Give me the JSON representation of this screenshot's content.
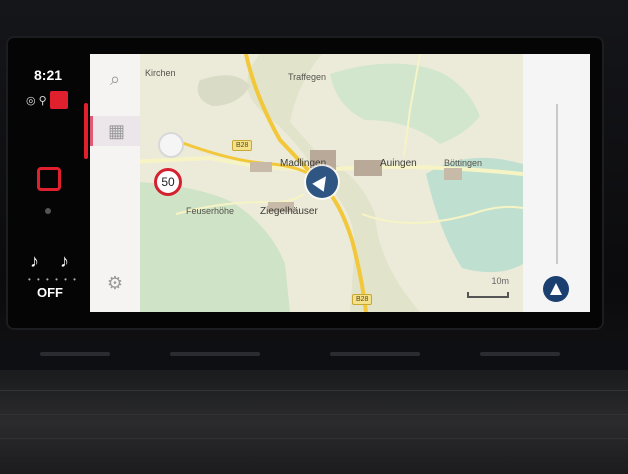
{
  "status": {
    "time": "8:21",
    "climate_label": "OFF"
  },
  "sidebar_tools": [
    {
      "name": "search-tool",
      "icon": "search-icon"
    },
    {
      "name": "map-view-tool",
      "icon": "map-icon",
      "active": true
    },
    {
      "name": "settings-tool",
      "icon": "gear-icon"
    }
  ],
  "map": {
    "speed_limit": "50",
    "places": [
      "Kirchen",
      "Traffegen",
      "Madlingen",
      "Auingen",
      "Böttingen",
      "Feuserhöhe",
      "Ziegelhäuser"
    ],
    "road_badges": [
      "B28",
      "B28"
    ],
    "scale_label": "10m"
  },
  "colors": {
    "accent": "#e1202d",
    "position_marker": "#2f5583"
  }
}
